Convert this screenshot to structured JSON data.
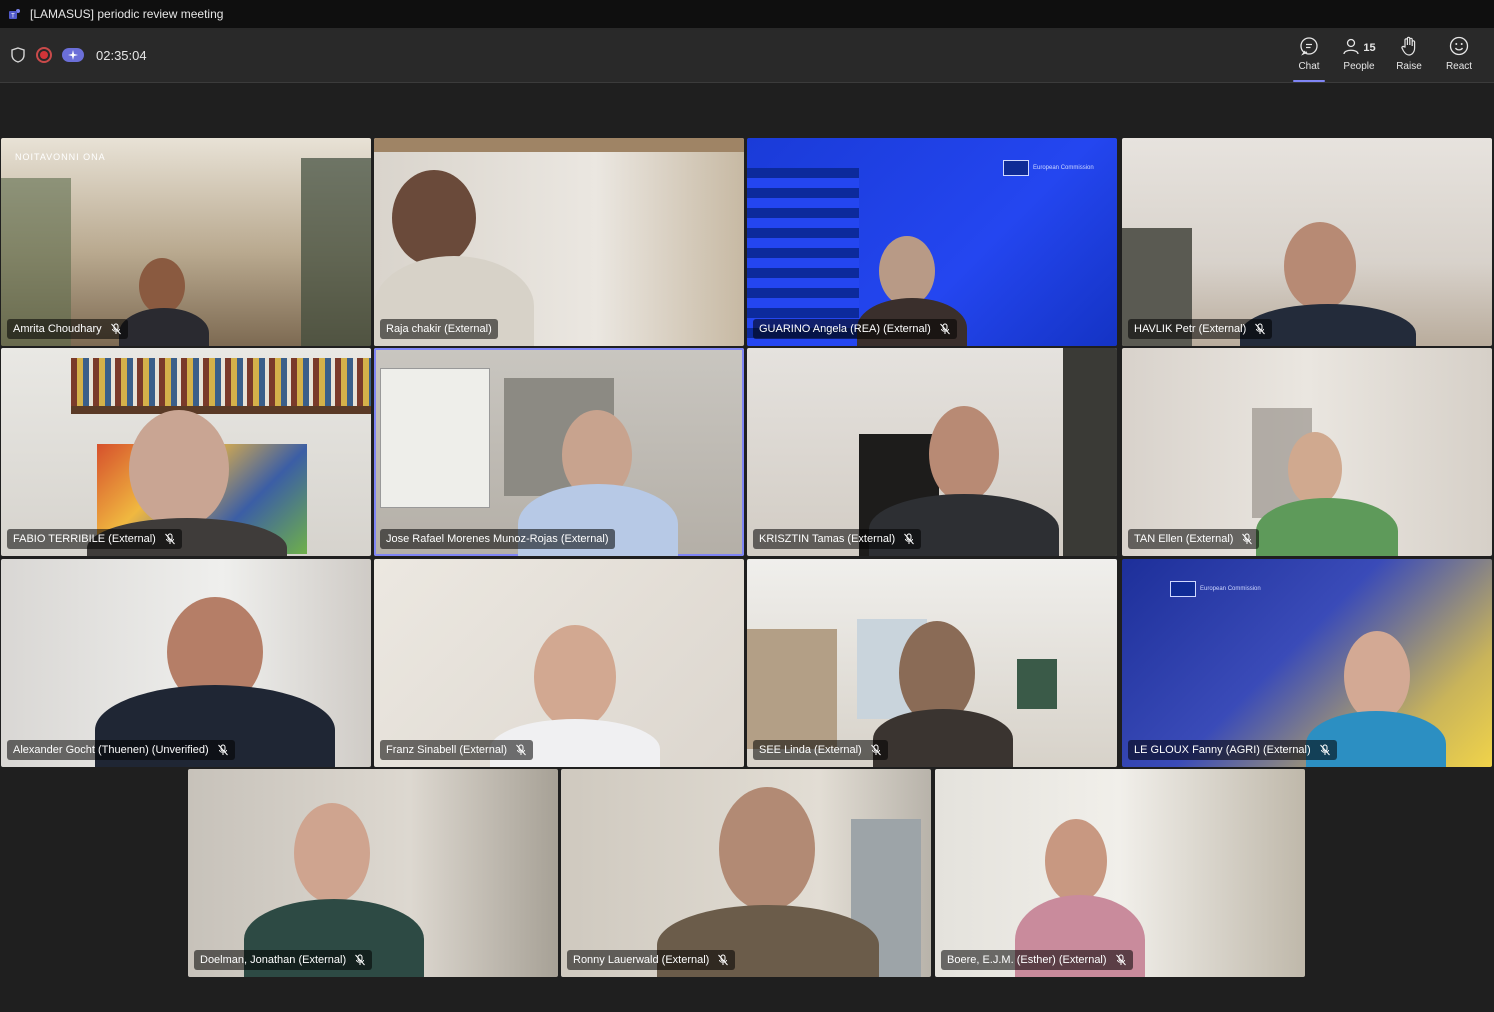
{
  "window": {
    "title": "[LAMASUS] periodic review meeting",
    "app_icon": "teams-icon"
  },
  "toolbar": {
    "timer": "02:35:04",
    "buttons": [
      {
        "label": "Chat",
        "icon": "chat-icon"
      },
      {
        "label": "People",
        "icon": "people-icon",
        "count": "15"
      },
      {
        "label": "Raise",
        "icon": "raise-hand-icon"
      },
      {
        "label": "React",
        "icon": "react-icon"
      }
    ]
  },
  "colors": {
    "accent": "#7f85f5",
    "record": "#d13438",
    "background": "#1f1f1f"
  },
  "tiles": [
    {
      "name": "Amrita Choudhary"
    },
    {
      "name": "Raja chakir (External)"
    },
    {
      "name": "GUARINO Angela (REA) (External)"
    },
    {
      "name": "HAVLIK Petr (External)"
    },
    {
      "name": "FABIO TERRIBILE (External)"
    },
    {
      "name": "Jose Rafael Morenes Munoz-Rojas (External)"
    },
    {
      "name": "KRISZTIN Tamas (External)"
    },
    {
      "name": "TAN Ellen (External)"
    },
    {
      "name": "Alexander Gocht (Thuenen) (Unverified)"
    },
    {
      "name": "Franz Sinabell (External)"
    },
    {
      "name": "SEE Linda (External)"
    },
    {
      "name": "LE GLOUX Fanny (AGRI) (External)"
    },
    {
      "name": "Doelman, Jonathan (External)"
    },
    {
      "name": "Ronny Lauerwald (External)"
    },
    {
      "name": "Boere, E.J.M. (Esther) (External)"
    }
  ]
}
